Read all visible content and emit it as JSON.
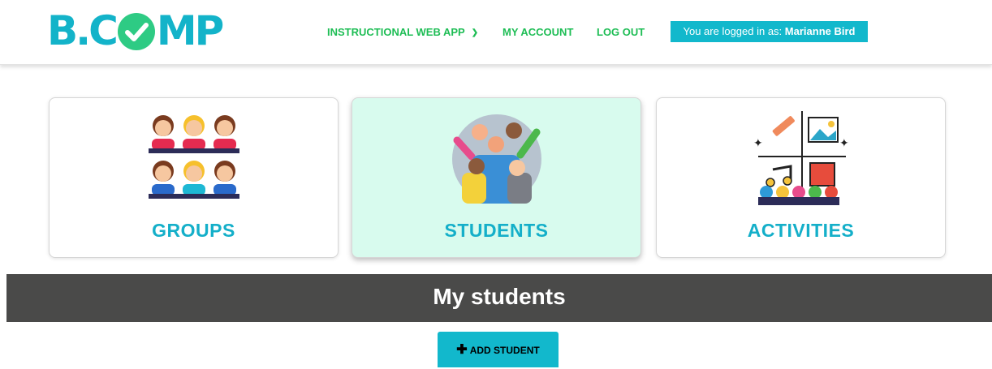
{
  "header": {
    "logo": {
      "left": "B.C",
      "right": "MP"
    },
    "nav": [
      {
        "label": "INSTRUCTIONAL WEB APP",
        "icon": "chevron-down-icon"
      },
      {
        "label": "MY ACCOUNT"
      },
      {
        "label": "LOG OUT"
      }
    ],
    "login": {
      "prefix": "You are logged in as:",
      "user": "Marianne Bird"
    }
  },
  "cards": [
    {
      "label": "GROUPS",
      "icon": "groups-illustration",
      "active": false
    },
    {
      "label": "STUDENTS",
      "icon": "students-illustration",
      "active": true
    },
    {
      "label": "ACTIVITIES",
      "icon": "activities-illustration",
      "active": false
    }
  ],
  "section": {
    "title": "My students"
  },
  "add_button": {
    "label": "ADD STUDENT",
    "icon": "plus-icon"
  },
  "colors": {
    "accent": "#12b8cc",
    "nav_green": "#1ebd55",
    "check_green": "#2ecb84",
    "active_card": "#d8fbee",
    "section_bar": "#4a4a49"
  }
}
